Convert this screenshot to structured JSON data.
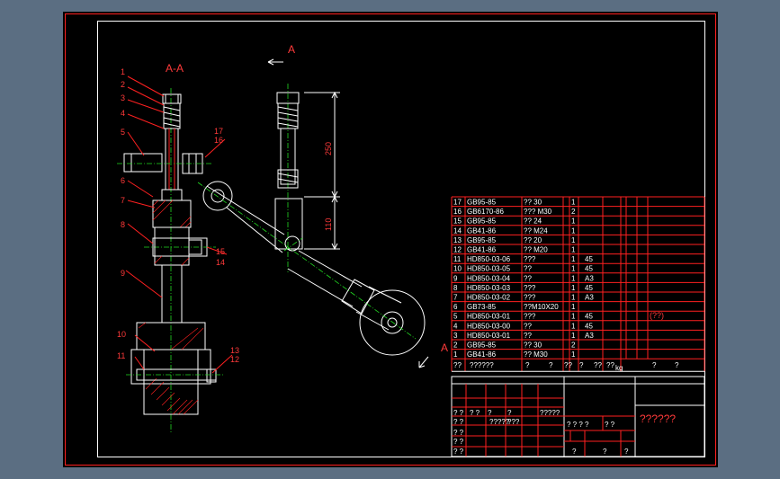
{
  "section_label": "A-A",
  "cut_label_top": "A",
  "cut_label_bottom": "A",
  "dimensions": {
    "upper": "250",
    "lower": "110"
  },
  "leaders": [
    "1",
    "2",
    "3",
    "4",
    "5",
    "6",
    "7",
    "8",
    "9",
    "10",
    "11",
    "12",
    "13",
    "14",
    "15",
    "16",
    "17"
  ],
  "bom_rows": [
    {
      "no": "17",
      "code": "GB95-85",
      "name": "?? 30",
      "qty": "1",
      "mat": ""
    },
    {
      "no": "16",
      "code": "GB6170-86",
      "name": "??? M30",
      "qty": "2",
      "mat": ""
    },
    {
      "no": "15",
      "code": "GB95-85",
      "name": "?? 24",
      "qty": "1",
      "mat": ""
    },
    {
      "no": "14",
      "code": "GB41-86",
      "name": "?? M24",
      "qty": "1",
      "mat": ""
    },
    {
      "no": "13",
      "code": "GB95-85",
      "name": "?? 20",
      "qty": "1",
      "mat": ""
    },
    {
      "no": "12",
      "code": "GB41-86",
      "name": "?? M20",
      "qty": "1",
      "mat": ""
    },
    {
      "no": "11",
      "code": "HD850-03-06",
      "name": "???",
      "qty": "1",
      "mat": "45"
    },
    {
      "no": "10",
      "code": "HD850-03-05",
      "name": "??",
      "qty": "1",
      "mat": "45"
    },
    {
      "no": "9",
      "code": "HD850-03-04",
      "name": "??",
      "qty": "1",
      "mat": "A3"
    },
    {
      "no": "8",
      "code": "HD850-03-03",
      "name": "???",
      "qty": "1",
      "mat": "45"
    },
    {
      "no": "7",
      "code": "HD850-03-02",
      "name": "???",
      "qty": "1",
      "mat": "A3"
    },
    {
      "no": "6",
      "code": "GB73-85",
      "name": "??M10X20",
      "qty": "1",
      "mat": ""
    },
    {
      "no": "5",
      "code": "HD850-03-01",
      "name": "???",
      "qty": "1",
      "mat": "45"
    },
    {
      "no": "4",
      "code": "HD850-03-00",
      "name": "??",
      "qty": "1",
      "mat": "45"
    },
    {
      "no": "3",
      "code": "HD850-03-01",
      "name": "??",
      "qty": "1",
      "mat": "A3"
    },
    {
      "no": "2",
      "code": "GB95-85",
      "name": "?? 30",
      "qty": "2",
      "mat": ""
    },
    {
      "no": "1",
      "code": "GB41-86",
      "name": "?? M30",
      "qty": "1",
      "mat": ""
    }
  ],
  "assembly_note": "(??)",
  "header_row": [
    "??",
    "??????",
    "?",
    "?",
    "??",
    "?",
    "??",
    "??",
    "?",
    "?"
  ],
  "header_sub": "kg",
  "title_block_name": "??????",
  "tb_cells": [
    "? ?",
    "? ?",
    "?",
    "?",
    "?????",
    "? ?",
    "?????",
    "???",
    "? ? ? ?",
    "? ?",
    "? ?",
    "? ?",
    "? ?",
    "?",
    "?",
    "?"
  ]
}
